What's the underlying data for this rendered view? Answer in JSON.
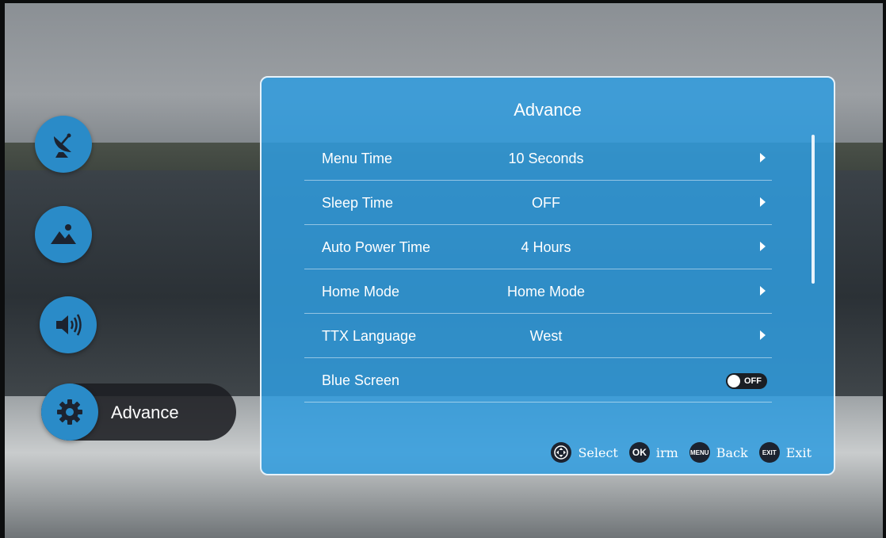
{
  "sidebar": {
    "items": [
      {
        "icon": "satellite-dish-icon"
      },
      {
        "icon": "picture-icon"
      },
      {
        "icon": "speaker-icon"
      },
      {
        "icon": "gear-icon",
        "label": "Advance"
      }
    ]
  },
  "panel": {
    "title": "Advance",
    "rows": [
      {
        "label": "Menu Time",
        "value": "10 Seconds"
      },
      {
        "label": "Sleep Time",
        "value": "OFF"
      },
      {
        "label": "Auto Power Time",
        "value": "4 Hours"
      },
      {
        "label": "Home Mode",
        "value": "Home Mode"
      },
      {
        "label": "TTX Language",
        "value": "West"
      },
      {
        "label": "Blue Screen",
        "toggle": "OFF"
      }
    ]
  },
  "footer": {
    "select": {
      "badge": "",
      "label": "Select"
    },
    "ok": {
      "badge": "OK",
      "label": "irm"
    },
    "back": {
      "badge": "MENU",
      "label": "Back"
    },
    "exit": {
      "badge": "EXIT",
      "label": "Exit"
    }
  },
  "colors": {
    "panel": "#309cde",
    "accent": "#2a8bc8"
  }
}
